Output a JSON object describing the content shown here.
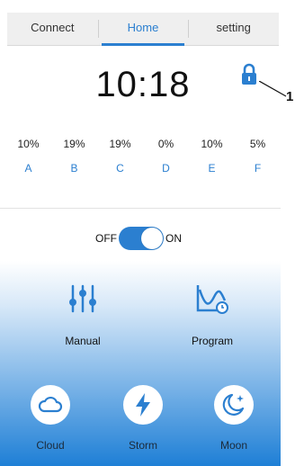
{
  "tabs": [
    {
      "label": "Connect",
      "active": false
    },
    {
      "label": "Home",
      "active": true
    },
    {
      "label": "setting",
      "active": false
    }
  ],
  "clock": {
    "time": "10:18"
  },
  "lock": {
    "icon": "lock-icon",
    "locked": true
  },
  "callout": {
    "number": "1"
  },
  "channels": [
    {
      "label": "A",
      "percent": "10%"
    },
    {
      "label": "B",
      "percent": "19%"
    },
    {
      "label": "C",
      "percent": "19%"
    },
    {
      "label": "D",
      "percent": "0%"
    },
    {
      "label": "E",
      "percent": "10%"
    },
    {
      "label": "F",
      "percent": "5%"
    }
  ],
  "power": {
    "off_label": "OFF",
    "on_label": "ON",
    "state": "on"
  },
  "modes": {
    "manual": {
      "label": "Manual",
      "icon": "sliders-icon"
    },
    "program": {
      "label": "Program",
      "icon": "schedule-chart-icon"
    },
    "cloud": {
      "label": "Cloud",
      "icon": "cloud-icon"
    },
    "storm": {
      "label": "Storm",
      "icon": "lightning-icon"
    },
    "moon": {
      "label": "Moon",
      "icon": "moon-icon"
    }
  },
  "colors": {
    "accent": "#2b7fd0",
    "panel_bottom": "#1e7fd6"
  }
}
